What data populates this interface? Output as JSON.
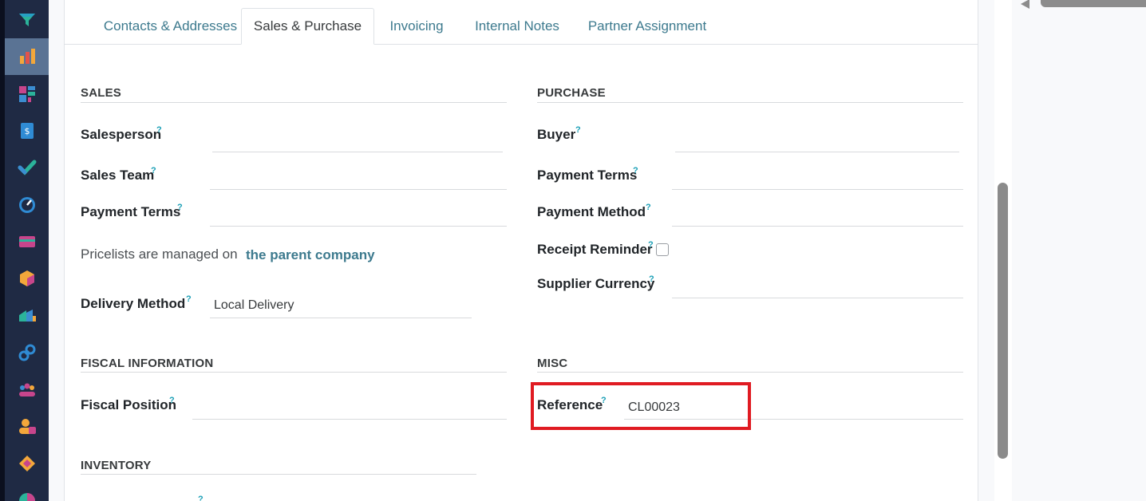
{
  "tabs": [
    {
      "label": "Contacts & Addresses"
    },
    {
      "label": "Sales & Purchase"
    },
    {
      "label": "Invoicing"
    },
    {
      "label": "Internal Notes"
    },
    {
      "label": "Partner Assignment"
    }
  ],
  "sidebar": {
    "icons": [
      "filter-icon",
      "dashboard-chart-icon",
      "knowledge-icon",
      "invoice-icon",
      "check-icon",
      "speedometer-icon",
      "card-icon",
      "cube-icon",
      "pricing-icon",
      "link-icon",
      "team-icon",
      "contacts-icon",
      "tag-icon",
      "pie-chart-icon"
    ]
  },
  "sales": {
    "title": "SALES",
    "salesperson_label": "Salesperson",
    "sales_team_label": "Sales Team",
    "payment_terms_label": "Payment Terms",
    "pricelist_text": "Pricelists are managed on",
    "pricelist_link": "the parent company",
    "delivery_method_label": "Delivery Method",
    "delivery_method_value": "Local Delivery"
  },
  "purchase": {
    "title": "PURCHASE",
    "buyer_label": "Buyer",
    "payment_terms_label": "Payment Terms",
    "payment_method_label": "Payment Method",
    "receipt_reminder_label": "Receipt Reminder",
    "supplier_currency_label": "Supplier Currency"
  },
  "fiscal": {
    "title": "FISCAL INFORMATION",
    "fiscal_position_label": "Fiscal Position"
  },
  "misc": {
    "title": "MISC",
    "reference_label": "Reference",
    "reference_value": "CL00023"
  },
  "inventory": {
    "title": "INVENTORY"
  },
  "help_mark": "?",
  "colors": {
    "sidebar": "#1f2a44",
    "link": "#3d7a8e",
    "help": "#1a9fb6",
    "highlight": "#e01b22"
  }
}
